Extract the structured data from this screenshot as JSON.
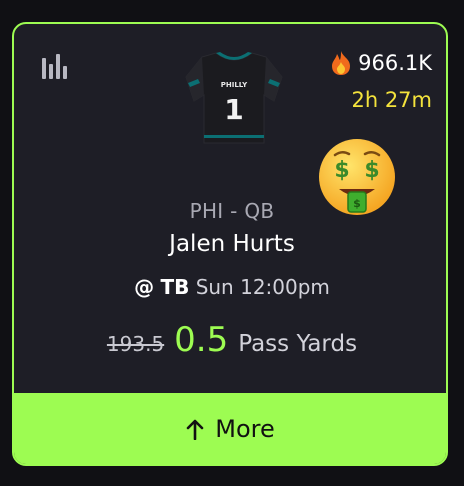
{
  "card": {
    "popularity": "966.1K",
    "countdown": "2h 27m",
    "jersey_text": "PHILLY",
    "jersey_number": "1",
    "team_position": "PHI - QB",
    "player_name": "Jalen Hurts",
    "opponent_prefix": "@",
    "opponent": "TB",
    "game_time": "Sun 12:00pm",
    "old_line": "193.5",
    "new_line": "0.5",
    "stat_label": "Pass Yards",
    "more_label": "More"
  },
  "icons": [
    "bar-chart-icon",
    "fire-icon",
    "money-mouth-face-icon",
    "arrow-up-icon"
  ],
  "colors": {
    "accent": "#9dfc52",
    "card_bg": "#1e1e26",
    "countdown": "#f4e33c",
    "muted": "#a9a9b3"
  }
}
